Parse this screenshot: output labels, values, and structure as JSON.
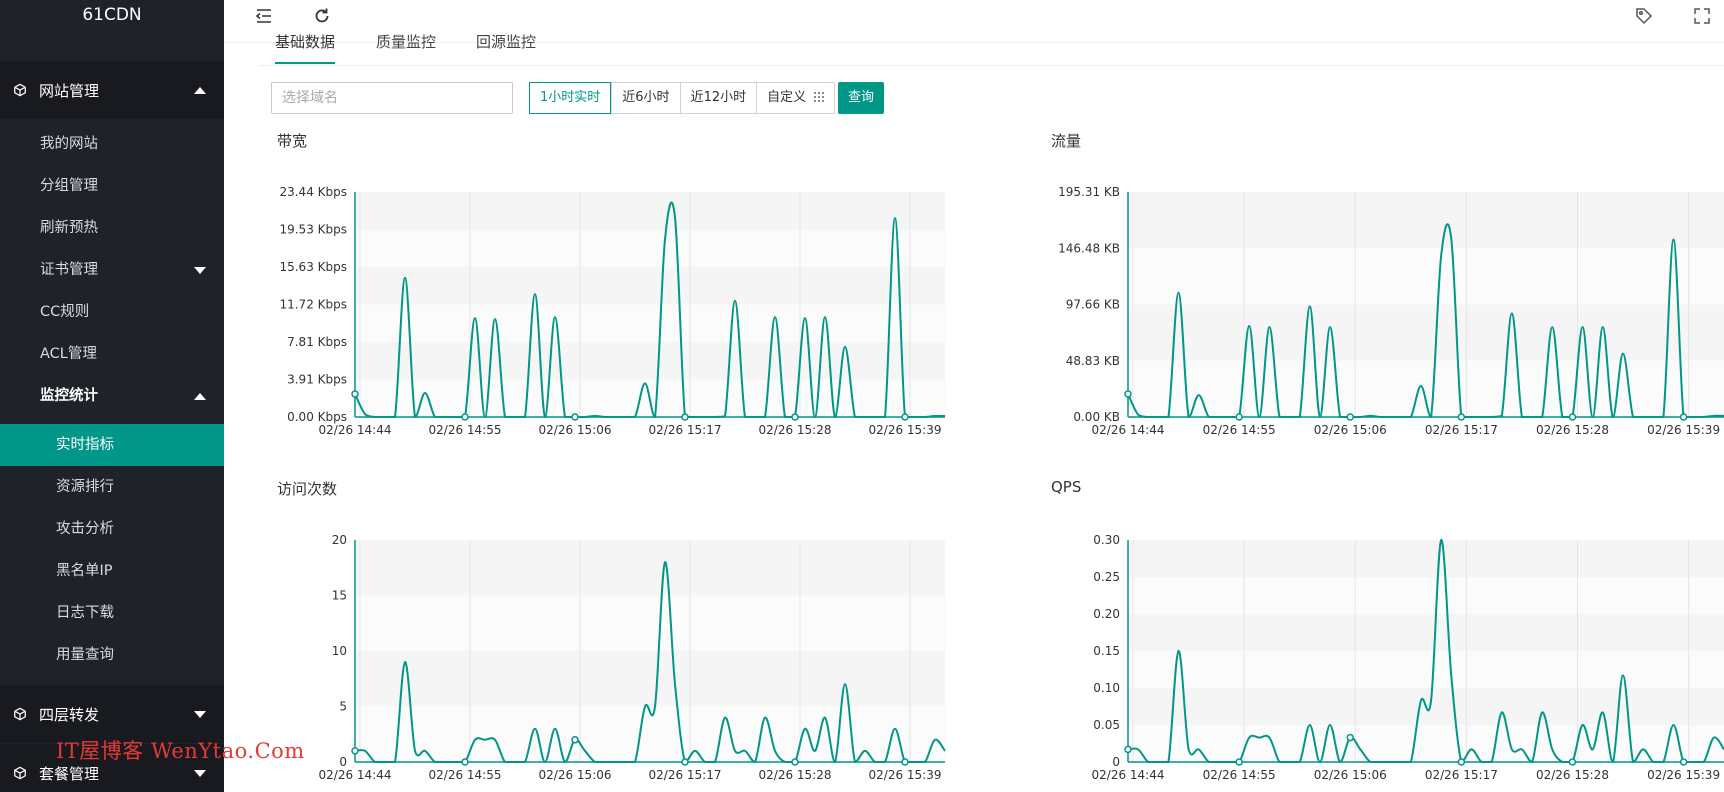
{
  "app": {
    "brand": "61CDN"
  },
  "sidebar": {
    "groups": [
      {
        "label": "网站管理",
        "expanded": true
      },
      {
        "label": "四层转发",
        "expanded": false
      },
      {
        "label": "套餐管理",
        "expanded": false
      }
    ],
    "items": [
      {
        "label": "我的网站"
      },
      {
        "label": "分组管理"
      },
      {
        "label": "刷新预热"
      },
      {
        "label": "证书管理"
      },
      {
        "label": "CC规则"
      },
      {
        "label": "ACL管理"
      },
      {
        "label": "监控统计"
      }
    ],
    "monitor_items": [
      {
        "label": "实时指标",
        "active": true
      },
      {
        "label": "资源排行"
      },
      {
        "label": "攻击分析"
      },
      {
        "label": "黑名单IP"
      },
      {
        "label": "日志下载"
      },
      {
        "label": "用量查询"
      }
    ]
  },
  "header": {
    "icons": [
      "menu-fold-icon",
      "refresh-icon",
      "tag-icon",
      "fullscreen-icon"
    ]
  },
  "tabs": [
    {
      "label": "基础数据",
      "active": true
    },
    {
      "label": "质量监控"
    },
    {
      "label": "回源监控"
    }
  ],
  "filter": {
    "domain_placeholder": "选择域名",
    "ranges": [
      {
        "label": "1小时实时",
        "active": true
      },
      {
        "label": "近6小时"
      },
      {
        "label": "近12小时"
      },
      {
        "label": "自定义"
      }
    ],
    "query_label": "查询"
  },
  "accent_color": "#009688",
  "chart_data": [
    {
      "type": "line",
      "title": "带宽",
      "x_tick_labels": [
        "02/26 14:44",
        "02/26 14:55",
        "02/26 15:06",
        "02/26 15:17",
        "02/26 15:28",
        "02/26 15:39"
      ],
      "y_tick_labels": [
        "0.00 Kbps",
        "3.91 Kbps",
        "7.81 Kbps",
        "11.72 Kbps",
        "15.63 Kbps",
        "19.53 Kbps",
        "23.44 Kbps"
      ],
      "ylim": [
        0,
        23.44
      ],
      "x_minutes": [
        0,
        1,
        2,
        3,
        4,
        5,
        6,
        7,
        8,
        9,
        10,
        11,
        12,
        13,
        14,
        15,
        16,
        17,
        18,
        19,
        20,
        21,
        22,
        23,
        24,
        25,
        26,
        27,
        28,
        29,
        30,
        31,
        32,
        33,
        34,
        35,
        36,
        37,
        38,
        39,
        40,
        41,
        42,
        43,
        44,
        45,
        46,
        47,
        48,
        49,
        50,
        51,
        52,
        53,
        54,
        55,
        56,
        57,
        58,
        59
      ],
      "series": [
        {
          "values": [
            2.4,
            0.3,
            0,
            0,
            0,
            14.5,
            0,
            2.5,
            0,
            0,
            0,
            0,
            10.3,
            0,
            10.2,
            0,
            0,
            0,
            12.8,
            0,
            10.4,
            0,
            0,
            0,
            0.1,
            0,
            0,
            0,
            0,
            3.5,
            0,
            18.5,
            20.8,
            0,
            0,
            0,
            0,
            0.1,
            12.1,
            0,
            0,
            0,
            10.4,
            0,
            0,
            10.3,
            0,
            10.4,
            0,
            7.3,
            0,
            0,
            0,
            0,
            20.7,
            0,
            0,
            0,
            0.1,
            0.1
          ]
        }
      ]
    },
    {
      "type": "line",
      "title": "流量",
      "x_tick_labels": [
        "02/26 14:44",
        "02/26 14:55",
        "02/26 15:06",
        "02/26 15:17",
        "02/26 15:28",
        "02/26 15:39"
      ],
      "y_tick_labels": [
        "0.00 KB",
        "48.83 KB",
        "97.66 KB",
        "146.48 KB",
        "195.31 KB"
      ],
      "ylim": [
        0,
        195.31
      ],
      "x_minutes": [
        0,
        1,
        2,
        3,
        4,
        5,
        6,
        7,
        8,
        9,
        10,
        11,
        12,
        13,
        14,
        15,
        16,
        17,
        18,
        19,
        20,
        21,
        22,
        23,
        24,
        25,
        26,
        27,
        28,
        29,
        30,
        31,
        32,
        33,
        34,
        35,
        36,
        37,
        38,
        39,
        40,
        41,
        42,
        43,
        44,
        45,
        46,
        47,
        48,
        49,
        50,
        51,
        52,
        53,
        54,
        55,
        56,
        57,
        58,
        59
      ],
      "series": [
        {
          "values": [
            20,
            2,
            0,
            0,
            0,
            108,
            0,
            19,
            0,
            0,
            0,
            0,
            79,
            0,
            78,
            0,
            0,
            0,
            96,
            0,
            78,
            0,
            0,
            0,
            1,
            0,
            0,
            0,
            0,
            27,
            0,
            140,
            155,
            0,
            0,
            0,
            0,
            1,
            90,
            0,
            0,
            0,
            78,
            0,
            0,
            78,
            0,
            78,
            0,
            55,
            0,
            0,
            0,
            0,
            154,
            0,
            0,
            0,
            1,
            1
          ]
        }
      ]
    },
    {
      "type": "line",
      "title": "访问次数",
      "x_tick_labels": [
        "02/26 14:44",
        "02/26 14:55",
        "02/26 15:06",
        "02/26 15:17",
        "02/26 15:28",
        "02/26 15:39"
      ],
      "y_tick_labels": [
        "0",
        "5",
        "10",
        "15",
        "20"
      ],
      "ylim": [
        0,
        20
      ],
      "x_minutes": [
        0,
        1,
        2,
        3,
        4,
        5,
        6,
        7,
        8,
        9,
        10,
        11,
        12,
        13,
        14,
        15,
        16,
        17,
        18,
        19,
        20,
        21,
        22,
        23,
        24,
        25,
        26,
        27,
        28,
        29,
        30,
        31,
        32,
        33,
        34,
        35,
        36,
        37,
        38,
        39,
        40,
        41,
        42,
        43,
        44,
        45,
        46,
        47,
        48,
        49,
        50,
        51,
        52,
        53,
        54,
        55,
        56,
        57,
        58,
        59
      ],
      "series": [
        {
          "values": [
            1,
            1,
            0,
            0,
            0,
            9,
            1,
            1,
            0,
            0,
            0,
            0,
            2,
            2,
            2,
            0,
            0,
            0,
            3,
            0,
            3,
            0,
            2,
            1,
            0,
            0,
            0,
            0,
            0,
            5,
            5,
            18,
            7,
            0,
            1,
            0,
            0,
            4,
            1,
            1,
            0,
            4,
            1,
            0,
            0,
            3,
            1,
            4,
            0,
            7,
            0,
            1,
            0,
            0,
            3,
            0,
            0,
            0,
            2,
            1
          ]
        }
      ]
    },
    {
      "type": "line",
      "title": "QPS",
      "x_tick_labels": [
        "02/26 14:44",
        "02/26 14:55",
        "02/26 15:06",
        "02/26 15:17",
        "02/26 15:28",
        "02/26 15:39"
      ],
      "y_tick_labels": [
        "0",
        "0.05",
        "0.10",
        "0.15",
        "0.20",
        "0.25",
        "0.30"
      ],
      "ylim": [
        0,
        0.3
      ],
      "x_minutes": [
        0,
        1,
        2,
        3,
        4,
        5,
        6,
        7,
        8,
        9,
        10,
        11,
        12,
        13,
        14,
        15,
        16,
        17,
        18,
        19,
        20,
        21,
        22,
        23,
        24,
        25,
        26,
        27,
        28,
        29,
        30,
        31,
        32,
        33,
        34,
        35,
        36,
        37,
        38,
        39,
        40,
        41,
        42,
        43,
        44,
        45,
        46,
        47,
        48,
        49,
        50,
        51,
        52,
        53,
        54,
        55,
        56,
        57,
        58,
        59
      ],
      "series": [
        {
          "values": [
            0.017,
            0.017,
            0,
            0,
            0,
            0.15,
            0.017,
            0.017,
            0,
            0,
            0,
            0,
            0.033,
            0.033,
            0.033,
            0,
            0,
            0,
            0.05,
            0,
            0.05,
            0,
            0.033,
            0.017,
            0,
            0,
            0,
            0,
            0,
            0.083,
            0.083,
            0.3,
            0.117,
            0,
            0.017,
            0,
            0,
            0.067,
            0.017,
            0.017,
            0,
            0.067,
            0.017,
            0,
            0,
            0.05,
            0.017,
            0.067,
            0,
            0.117,
            0,
            0.017,
            0,
            0,
            0.05,
            0,
            0,
            0,
            0.033,
            0.017
          ]
        }
      ]
    }
  ],
  "watermark": "IT屋博客 WenYtao.Com"
}
